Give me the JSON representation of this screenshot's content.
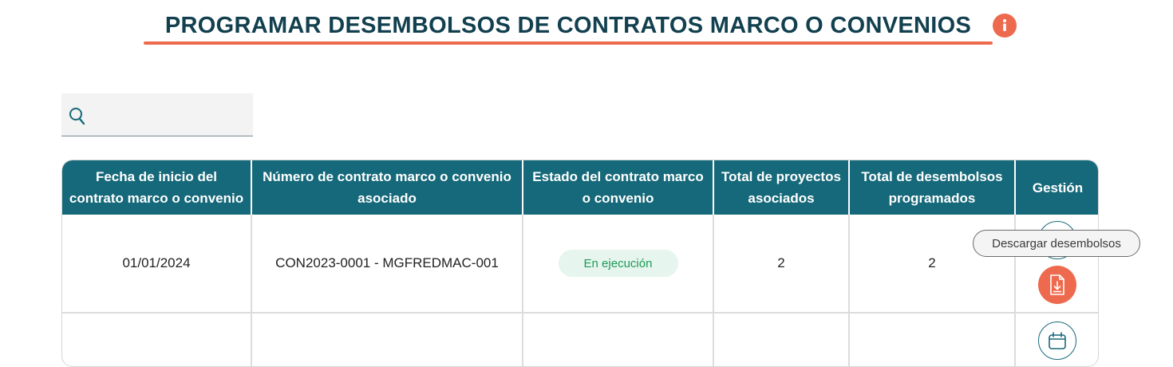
{
  "page": {
    "title": "PROGRAMAR DESEMBOLSOS DE CONTRATOS MARCO O CONVENIOS",
    "info_icon": "info-icon"
  },
  "search": {
    "value": "",
    "placeholder": "",
    "icon": "search-icon"
  },
  "table": {
    "headers": [
      "Fecha de inicio del contrato marco o convenio",
      "Número de contrato marco o convenio asociado",
      "Estado del contrato marco o convenio",
      "Total de proyectos asociados",
      "Total de desembolsos programados",
      "Gestión"
    ],
    "rows": [
      {
        "fecha": "01/01/2024",
        "numero": "CON2023-0001 - MGFREDMAC-001",
        "estado": "En ejecución",
        "total_proyectos": "2",
        "total_desembolsos": "2",
        "actions": [
          "calendar-icon",
          "download-icon"
        ]
      },
      {
        "fecha": "",
        "numero": "",
        "estado": "",
        "total_proyectos": "",
        "total_desembolsos": "",
        "actions": [
          "calendar-icon"
        ]
      }
    ]
  },
  "tooltip": {
    "text": "Descargar desembolsos"
  },
  "colors": {
    "header_bg": "#16697a",
    "title": "#12404f",
    "accent": "#ee6a4e",
    "status_bg": "#e6f5ee",
    "status_text": "#1e9a57"
  }
}
